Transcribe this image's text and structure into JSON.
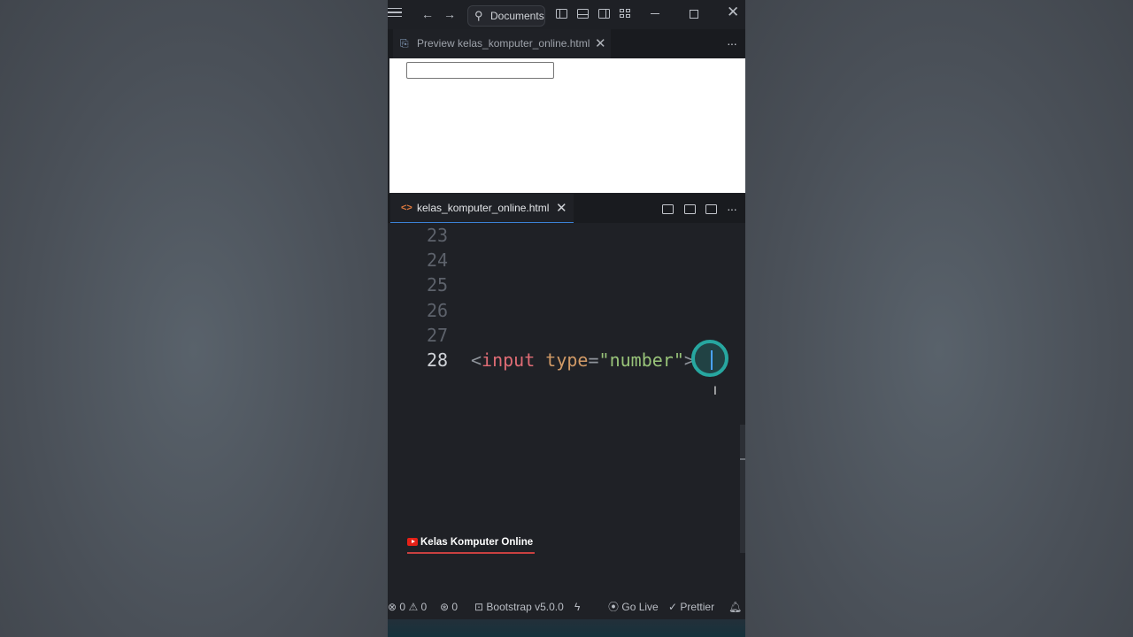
{
  "titlebar": {
    "back_icon": "←",
    "forward_icon": "→",
    "search_label": "Documents",
    "search_icon": "⚲",
    "close_icon": "✕"
  },
  "preview_tab": {
    "label": "Preview kelas_komputer_online.html",
    "close_icon": "✕",
    "more_icon": "···"
  },
  "editor_tab": {
    "label": "kelas_komputer_online.html",
    "file_icon": "<>",
    "close_icon": "✕",
    "more_icon": "···"
  },
  "editor": {
    "line_numbers": [
      "23",
      "24",
      "25",
      "26",
      "27",
      "28"
    ],
    "active_line": "28",
    "code_tokens": {
      "open": "<",
      "tag": "input",
      "attr": " type",
      "eq": "=",
      "value": "\"number\"",
      "close": ">"
    }
  },
  "watermark": {
    "text": "Kelas Komputer Online"
  },
  "statusbar": {
    "errors": "0",
    "warnings": "0",
    "ports": "0",
    "bootstrap": "Bootstrap v5.0.0",
    "go_live": "Go Live",
    "prettier": "Prettier"
  },
  "colors": {
    "accent": "#27a7a0",
    "tab_active_border": "#3b82d6",
    "tag": "#e06c75",
    "attr": "#d19a66",
    "string": "#98c379"
  }
}
